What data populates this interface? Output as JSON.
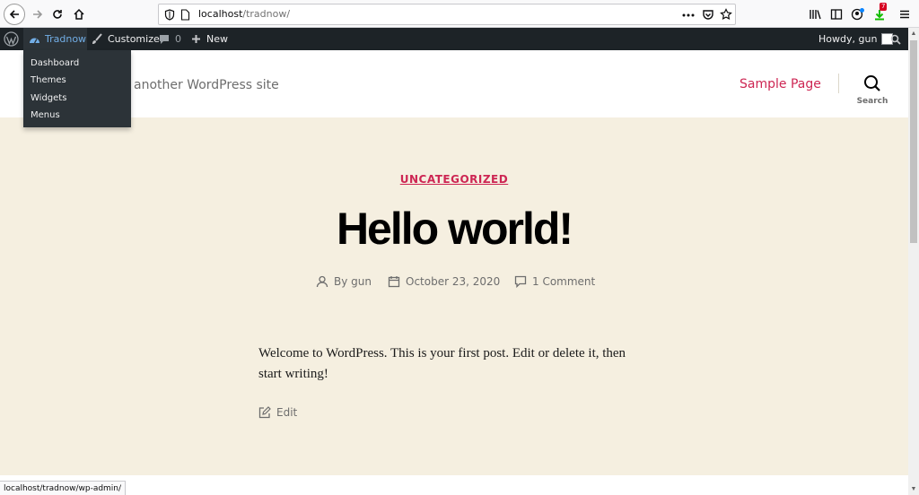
{
  "browser": {
    "url_host": "localhost",
    "url_path": "/tradnow/",
    "download_badge": "7"
  },
  "adminbar": {
    "site_name": "Tradnow",
    "customize": "Customize",
    "comments_count": "0",
    "new_label": "New",
    "howdy": "Howdy, gun"
  },
  "site_menu": {
    "items": [
      "Dashboard",
      "Themes",
      "Widgets",
      "Menus"
    ]
  },
  "header": {
    "tagline": "another WordPress site",
    "nav_item": "Sample Page",
    "search_label": "Search"
  },
  "post": {
    "category": "UNCATEGORIZED",
    "title": "Hello world!",
    "author": "By gun",
    "date": "October 23, 2020",
    "comments": "1 Comment",
    "body": "Welcome to WordPress. This is your first post. Edit or delete it, then start writing!",
    "edit_label": "Edit"
  },
  "statusbar": {
    "text": "localhost/tradnow/wp-admin/"
  },
  "colors": {
    "accent": "#cd2653",
    "content_bg": "#f5efe0",
    "adminbar_bg": "#1d2327",
    "adminbar_highlight": "#72aee6"
  },
  "icons": [
    "back-icon",
    "forward-icon",
    "reload-icon",
    "home-icon",
    "shield-icon",
    "page-icon",
    "more-icon",
    "pocket-icon",
    "bookmark-star-icon",
    "library-icon",
    "sidebar-icon",
    "account-icon",
    "download-icon",
    "hamburger-menu-icon",
    "wordpress-logo-icon",
    "dashboard-icon",
    "brush-icon",
    "comment-bubble-icon",
    "plus-icon",
    "avatar-icon",
    "search-icon",
    "person-icon",
    "calendar-icon",
    "comment-icon",
    "edit-icon"
  ]
}
